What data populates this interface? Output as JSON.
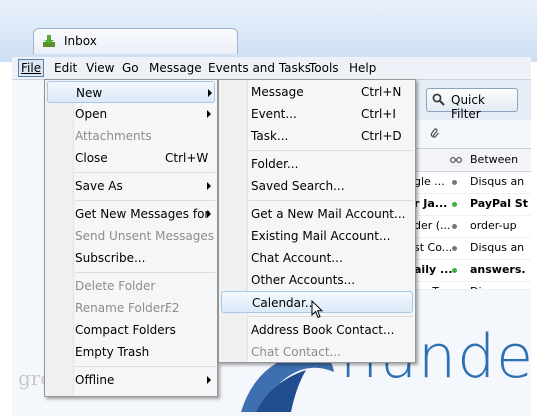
{
  "window": {
    "tab_title": "Inbox"
  },
  "menubar": {
    "items": [
      "File",
      "Edit",
      "View",
      "Go",
      "Message",
      "Events and Tasks",
      "Tools",
      "Help"
    ]
  },
  "toolbar": {
    "quick_filter": "Quick Filter"
  },
  "file_menu": {
    "new": "New",
    "open": "Open",
    "attachments": "Attachments",
    "close": "Close",
    "close_sc": "Ctrl+W",
    "save_as": "Save As",
    "get_new_messages_for": "Get New Messages for",
    "send_unsent": "Send Unsent Messages",
    "subscribe": "Subscribe...",
    "delete_folder": "Delete Folder",
    "rename_folder": "Rename Folder...",
    "rename_sc": "F2",
    "compact_folders": "Compact Folders",
    "empty_trash": "Empty Trash",
    "offline": "Offline"
  },
  "new_menu": {
    "message": "Message",
    "message_sc": "Ctrl+N",
    "event": "Event...",
    "event_sc": "Ctrl+I",
    "task": "Task...",
    "task_sc": "Ctrl+D",
    "folder": "Folder...",
    "saved_search": "Saved Search...",
    "get_new_mail_account": "Get a New Mail Account...",
    "existing_mail_account": "Existing Mail Account...",
    "chat_account": "Chat Account...",
    "other_accounts": "Other Accounts...",
    "calendar": "Calendar...",
    "address_book_contact": "Address Book Contact...",
    "chat_contact": "Chat Contact..."
  },
  "message_list": {
    "header_between": "Between",
    "rows": [
      {
        "c1": "gle ...",
        "c2": "Disqus an",
        "dot": "gray",
        "bold": false
      },
      {
        "c1": "r Ja...",
        "c2": "PayPal St",
        "dot": "green",
        "bold": true
      },
      {
        "c1": "der (...",
        "c2": "order-up",
        "dot": "gray",
        "bold": false
      },
      {
        "c1": "st Co...",
        "c2": "Disqus an",
        "dot": "gray",
        "bold": false
      },
      {
        "c1": "aily ...",
        "c2": "answers.",
        "dot": "green",
        "bold": true
      },
      {
        "c1": "t... T...",
        "c2": "Disqus an",
        "dot": "gray",
        "bold": false
      }
    ]
  },
  "branding_text": "hunde",
  "watermark": "groovyPost.com",
  "colors": {
    "highlight": "#dbe9f8",
    "brand_blue": "#2c6fb2",
    "accent_green": "#3fae3f"
  }
}
